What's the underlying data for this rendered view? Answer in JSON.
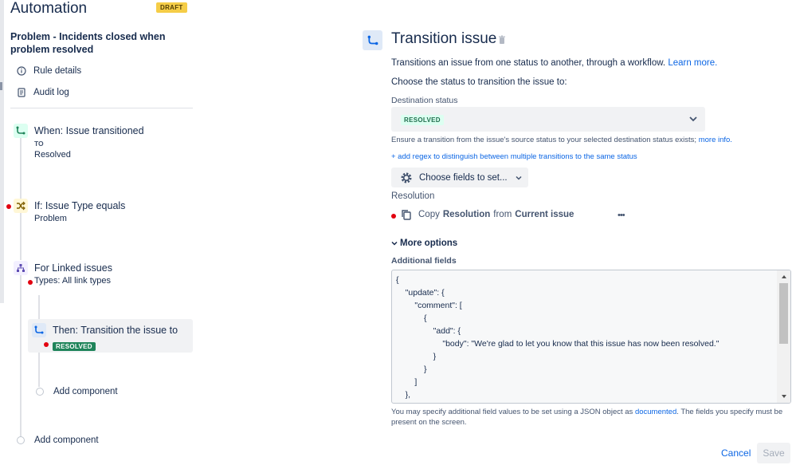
{
  "header": {
    "app_title": "Automation",
    "status_badge": "DRAFT"
  },
  "rule": {
    "name": "Problem - Incidents closed when problem resolved"
  },
  "sidebar_links": [
    {
      "label": "Rule details",
      "icon": "info-icon"
    },
    {
      "label": "Audit log",
      "icon": "document-icon"
    }
  ],
  "steps": {
    "trigger": {
      "title": "When: Issue transitioned",
      "keyword": "TO",
      "value": "Resolved",
      "icon": "transition-icon"
    },
    "condition": {
      "title": "If: Issue Type equals",
      "value": "Problem",
      "icon": "shuffle-icon"
    },
    "branch": {
      "title": "For Linked issues",
      "value": "Types: All link types",
      "icon": "hierarchy-icon"
    },
    "action": {
      "title": "Then: Transition the issue to",
      "status": "RESOLVED",
      "icon": "transition-icon"
    },
    "add_component_inner": "Add component",
    "add_component_outer": "Add component"
  },
  "panel": {
    "title": "Transition issue",
    "description": "Transitions an issue from one status to another, through a workflow.",
    "learn_more": "Learn more.",
    "choose_prompt": "Choose the status to transition the issue to:",
    "destination_label": "Destination status",
    "destination_value": "RESOLVED",
    "hint_text": "Ensure a transition from the issue's source status to your selected destination status exists;",
    "hint_link": "more info.",
    "regex_link": "+ add regex to distinguish between multiple transitions to the same status",
    "choose_fields_label": "Choose fields to set...",
    "resolution_label": "Resolution",
    "copy": {
      "prefix": "Copy",
      "field": "Resolution",
      "middle": "from",
      "source": "Current issue",
      "more": "•••"
    },
    "more_options_label": "More options",
    "additional_fields_label": "Additional fields",
    "json_lines": [
      "{",
      "    \"update\": {",
      "        \"comment\": [",
      "            {",
      "                \"add\": {",
      "                    \"body\": \"We're glad to let you know that this issue has now been resolved.\"",
      "                }",
      "            }",
      "        ]",
      "    },"
    ],
    "footer_text": "You may specify additional field values to be set using a JSON object as",
    "footer_link": "documented",
    "footer_text2": ". The fields you specify must be present on the screen.",
    "cancel_label": "Cancel",
    "save_label": "Save"
  },
  "colors": {
    "draft": "#f5cd47",
    "resolved_green": "#1f845a",
    "link_blue": "#0c66e4",
    "error_red": "#e2000f"
  }
}
